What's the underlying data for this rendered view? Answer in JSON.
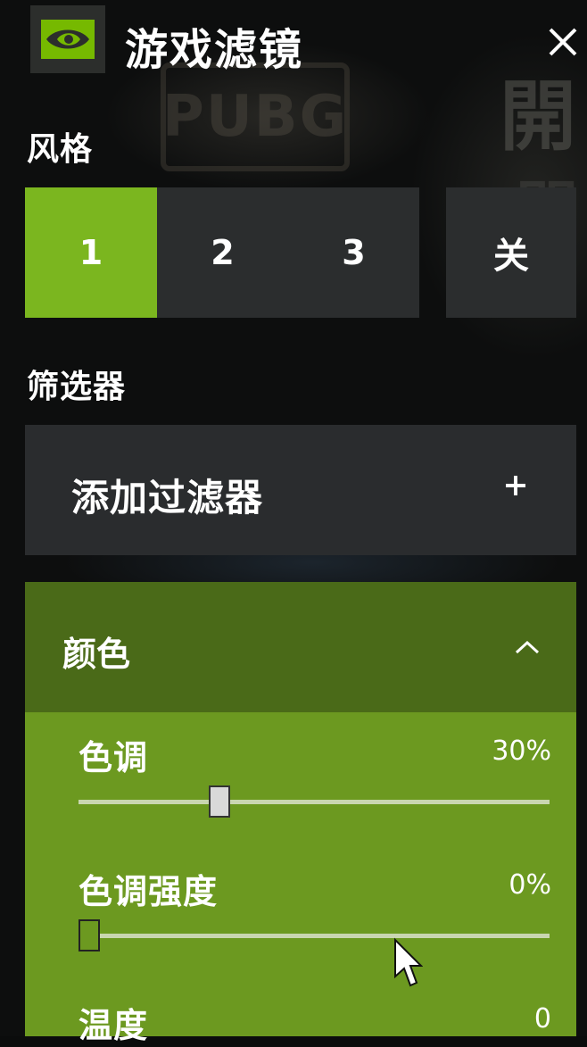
{
  "header": {
    "title": "游戏滤镜",
    "logo_icon": "nvidia-eye-icon",
    "close_icon": "close-icon"
  },
  "background": {
    "game_logo_text": "PUBG",
    "side_char_1": "開",
    "side_char_2": "開"
  },
  "style_section": {
    "label": "风格",
    "options": [
      "1",
      "2",
      "3"
    ],
    "selected": "1",
    "off_label": "关"
  },
  "filter_section": {
    "label": "筛选器",
    "add_filter_label": "添加过滤器",
    "add_icon": "plus-icon"
  },
  "color_filter": {
    "title": "颜色",
    "collapse_icon": "chevron-up-icon",
    "sliders": [
      {
        "label": "色调",
        "value_text": "30%",
        "value": 0.3
      },
      {
        "label": "色调强度",
        "value_text": "0%",
        "value": 0.0
      },
      {
        "label": "温度",
        "value_text": "0"
      }
    ]
  },
  "colors": {
    "accent": "#7bb61f",
    "panel_dark": "#2b2d2e",
    "section_green": "#6c9920",
    "section_header_green": "#4a6a18"
  }
}
